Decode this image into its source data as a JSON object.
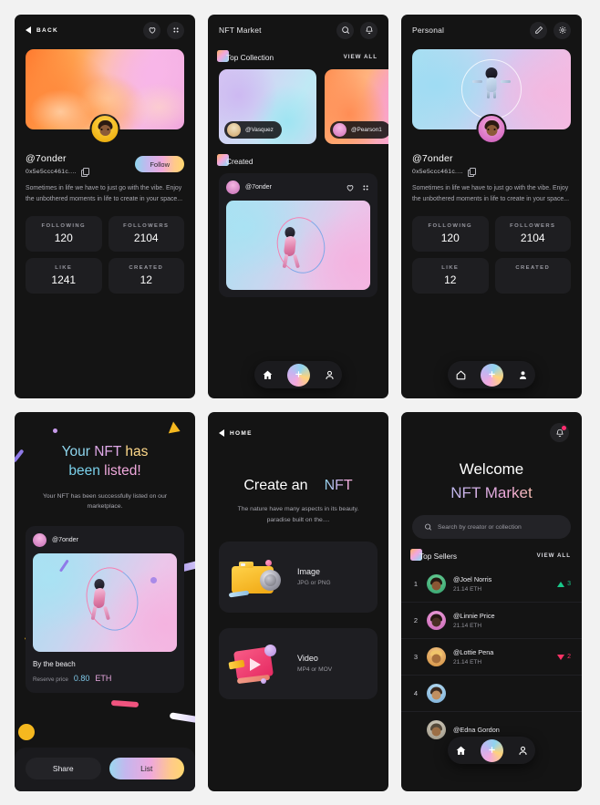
{
  "profile_screen": {
    "back_label": "BACK",
    "icons": {
      "heart": "heart-icon",
      "grid": "grid-dots-icon"
    },
    "username": "@7onder",
    "address": "0x5e5ccc461c....",
    "follow_label": "Follow",
    "bio": "Sometimes in life we have to just go with the vibe. Enjoy the unbothered moments in life to create in your space...",
    "stats": [
      {
        "label": "FOLLOWING",
        "value": "120"
      },
      {
        "label": "FOLLOWERS",
        "value": "2104"
      },
      {
        "label": "LIKE",
        "value": "1241"
      },
      {
        "label": "CREATED",
        "value": "12"
      }
    ]
  },
  "market_screen": {
    "title": "NFT Market",
    "icons": {
      "search": "search-icon",
      "bell": "bell-icon"
    },
    "top_collection": {
      "title": "Top Collection",
      "view_all": "VIEW ALL",
      "cards": [
        {
          "creator": "@Vasquez"
        },
        {
          "creator": "@Pearson1"
        }
      ]
    },
    "created": {
      "title": "Created",
      "card": {
        "username": "@7onder",
        "heart_icon": "heart-icon",
        "grid_icon": "grid-dots-icon"
      }
    },
    "nav": {
      "home": "home-icon",
      "add": "plus-icon",
      "profile": "person-icon"
    }
  },
  "personal_screen": {
    "title": "Personal",
    "icons": {
      "edit": "pencil-icon",
      "settings": "gear-icon"
    },
    "username": "@7onder",
    "address": "0x5e5ccc461c....",
    "bio": "Sometimes in life we have to just go with the vibe. Enjoy the unbothered moments in life to create in your space...",
    "stats": [
      {
        "label": "FOLLOWING",
        "value": "120"
      },
      {
        "label": "FOLLOWERS",
        "value": "2104"
      },
      {
        "label": "LIKE",
        "value": "12"
      },
      {
        "label": "CREATED",
        "value": ""
      }
    ],
    "nav": {
      "home": "home-icon",
      "add": "plus-icon",
      "profile": "person-icon"
    }
  },
  "listed_screen": {
    "title_words": {
      "your": "Your",
      "nft": "NFT",
      "has": "has",
      "been": "been",
      "listed": "listed!"
    },
    "subtitle": "Your NFT has been successfully listed on our marketplace.",
    "card": {
      "username": "@7onder",
      "nft_title": "By the beach",
      "price_label": "Reserve price",
      "price_value": "0.80",
      "price_currency": "ETH"
    },
    "actions": {
      "share": "Share",
      "list": "List"
    }
  },
  "create_screen": {
    "back_label": "HOME",
    "title_plain": "Create an",
    "title_accent": "NFT",
    "subtitle": "The nature have many aspects in its beauty. paradise built on the....",
    "options": [
      {
        "title": "Image",
        "subtitle": "JPG or PNG",
        "icon": "camera-icon"
      },
      {
        "title": "Video",
        "subtitle": "MP4 or MOV",
        "icon": "video-icon"
      }
    ]
  },
  "welcome_screen": {
    "bell_icon": "bell-icon",
    "heading_line1": "Welcome",
    "heading_line2": "NFT Market",
    "search_placeholder": "Search by creator or collection",
    "top_sellers": {
      "title": "Top Sellers",
      "view_all": "VIEW ALL",
      "rows": [
        {
          "rank": "1",
          "name": "@Joel Norris",
          "eth": "21.14 ETH",
          "badge": "3",
          "badge_dir": "up"
        },
        {
          "rank": "2",
          "name": "@Linnie Price",
          "eth": "21.14 ETH",
          "badge": "",
          "badge_dir": "none"
        },
        {
          "rank": "3",
          "name": "@Lottie Pena",
          "eth": "21.14 ETH",
          "badge": "2",
          "badge_dir": "down"
        },
        {
          "rank": "4",
          "name": "",
          "eth": "",
          "badge": "",
          "badge_dir": "none"
        },
        {
          "rank": "",
          "name": "@Edna Gordon",
          "eth": "",
          "badge": "",
          "badge_dir": "none"
        }
      ]
    },
    "nav": {
      "home": "home-icon",
      "add": "plus-icon",
      "profile": "person-icon"
    }
  },
  "colors": {
    "background": "#f2f2f2",
    "panel": "#141414",
    "card": "#1e1e22",
    "accent_green": "#19c98a",
    "accent_red": "#ff3366",
    "notification_dot": "#ff2d6f"
  }
}
